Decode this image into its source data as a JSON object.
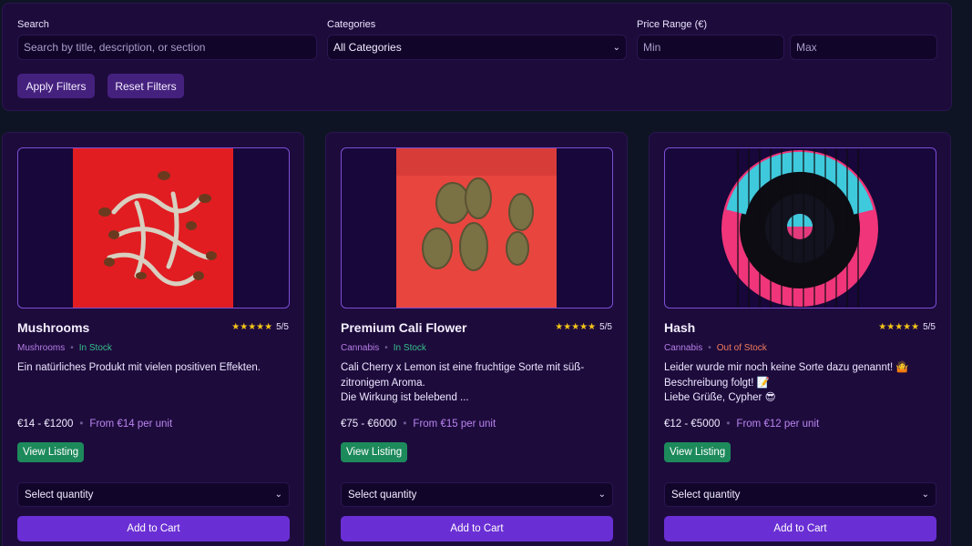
{
  "filters": {
    "search_label": "Search",
    "search_placeholder": "Search by title, description, or section",
    "categories_label": "Categories",
    "categories_selected": "All Categories",
    "price_label": "Price Range (€)",
    "min_placeholder": "Min",
    "max_placeholder": "Max",
    "apply_label": "Apply Filters",
    "reset_label": "Reset Filters"
  },
  "products": [
    {
      "title": "Mushrooms",
      "rating": "5/5",
      "stars": "★★★★★",
      "category": "Mushrooms",
      "stock": "In Stock",
      "description": [
        "Ein natürliches Produkt mit vielen positiven Effekten."
      ],
      "price_range": "€14 - €1200",
      "unit_price": "From €14 per unit",
      "view_label": "View Listing",
      "qty_label": "Select quantity",
      "cart_label": "Add to Cart"
    },
    {
      "title": "Premium Cali Flower",
      "rating": "5/5",
      "stars": "★★★★★",
      "category": "Cannabis",
      "stock": "In Stock",
      "description": [
        "Cali Cherry x Lemon ist eine fruchtige Sorte mit süß-zitronigem Aroma.",
        "Die Wirkung ist belebend ..."
      ],
      "price_range": "€75 - €6000",
      "unit_price": "From €15 per unit",
      "view_label": "View Listing",
      "qty_label": "Select quantity",
      "cart_label": "Add to Cart"
    },
    {
      "title": "Hash",
      "rating": "5/5",
      "stars": "★★★★★",
      "category": "Cannabis",
      "stock": "Out of Stock",
      "description": [
        "Leider wurde mir noch keine Sorte dazu genannt! 🤷",
        "Beschreibung folgt! 📝",
        "Liebe Grüße, Cypher 😎"
      ],
      "price_range": "€12 - €5000",
      "unit_price": "From €12 per unit",
      "view_label": "View Listing",
      "qty_label": "Select quantity",
      "cart_label": "Add to Cart"
    }
  ],
  "colors": {
    "accent": "#6a2fd4",
    "in_stock": "#35c08a",
    "out_of_stock": "#f37c5c",
    "view_button": "#1d8a5c"
  }
}
